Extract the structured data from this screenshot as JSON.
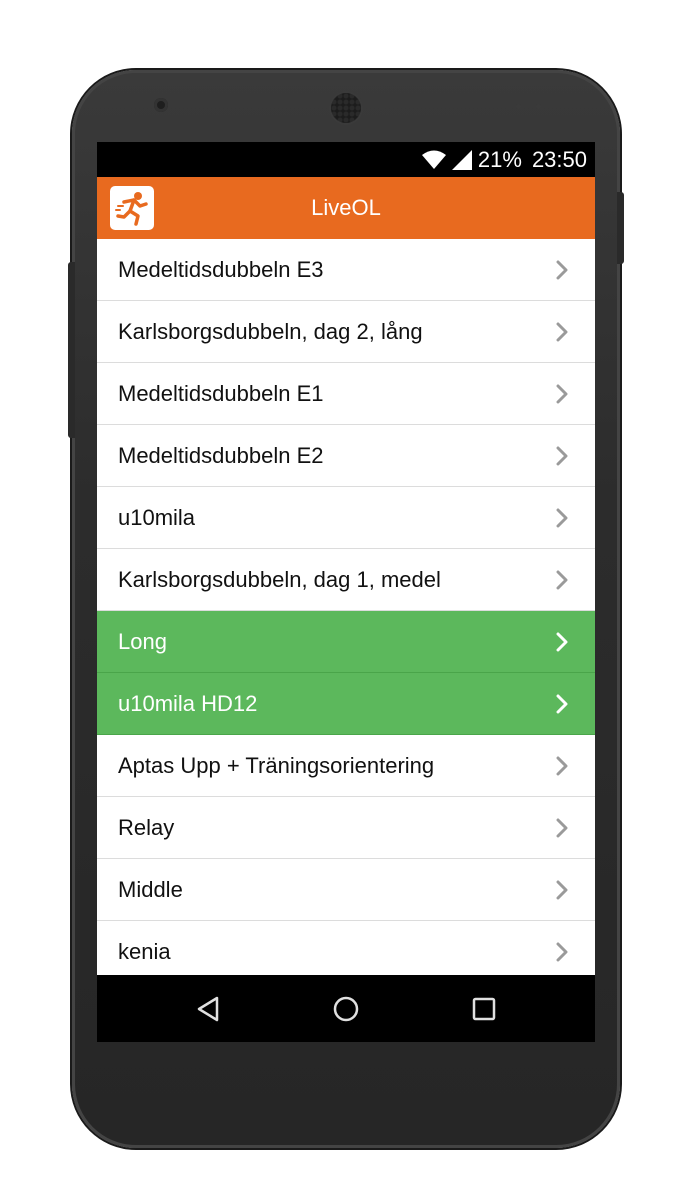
{
  "status_bar": {
    "battery": "21%",
    "time": "23:50"
  },
  "app_bar": {
    "title": "LiveOL",
    "icon": "runner-icon",
    "color": "#e86a1f"
  },
  "list": {
    "highlight_color": "#5cb85c",
    "items": [
      {
        "label": "Medeltidsdubbeln E3",
        "highlighted": false
      },
      {
        "label": "Karlsborgsdubbeln, dag 2, lång",
        "highlighted": false
      },
      {
        "label": "Medeltidsdubbeln E1",
        "highlighted": false
      },
      {
        "label": "Medeltidsdubbeln E2",
        "highlighted": false
      },
      {
        "label": "u10mila",
        "highlighted": false
      },
      {
        "label": "Karlsborgsdubbeln, dag 1, medel",
        "highlighted": false
      },
      {
        "label": "Long",
        "highlighted": true
      },
      {
        "label": "u10mila HD12",
        "highlighted": true
      },
      {
        "label": "Aptas Upp + Träningsorientering",
        "highlighted": false
      },
      {
        "label": "Relay",
        "highlighted": false
      },
      {
        "label": "Middle",
        "highlighted": false
      },
      {
        "label": "kenia",
        "highlighted": false
      }
    ]
  },
  "nav_bar": {
    "back_icon": "back-triangle-icon",
    "home_icon": "home-circle-icon",
    "recents_icon": "recents-square-icon"
  }
}
